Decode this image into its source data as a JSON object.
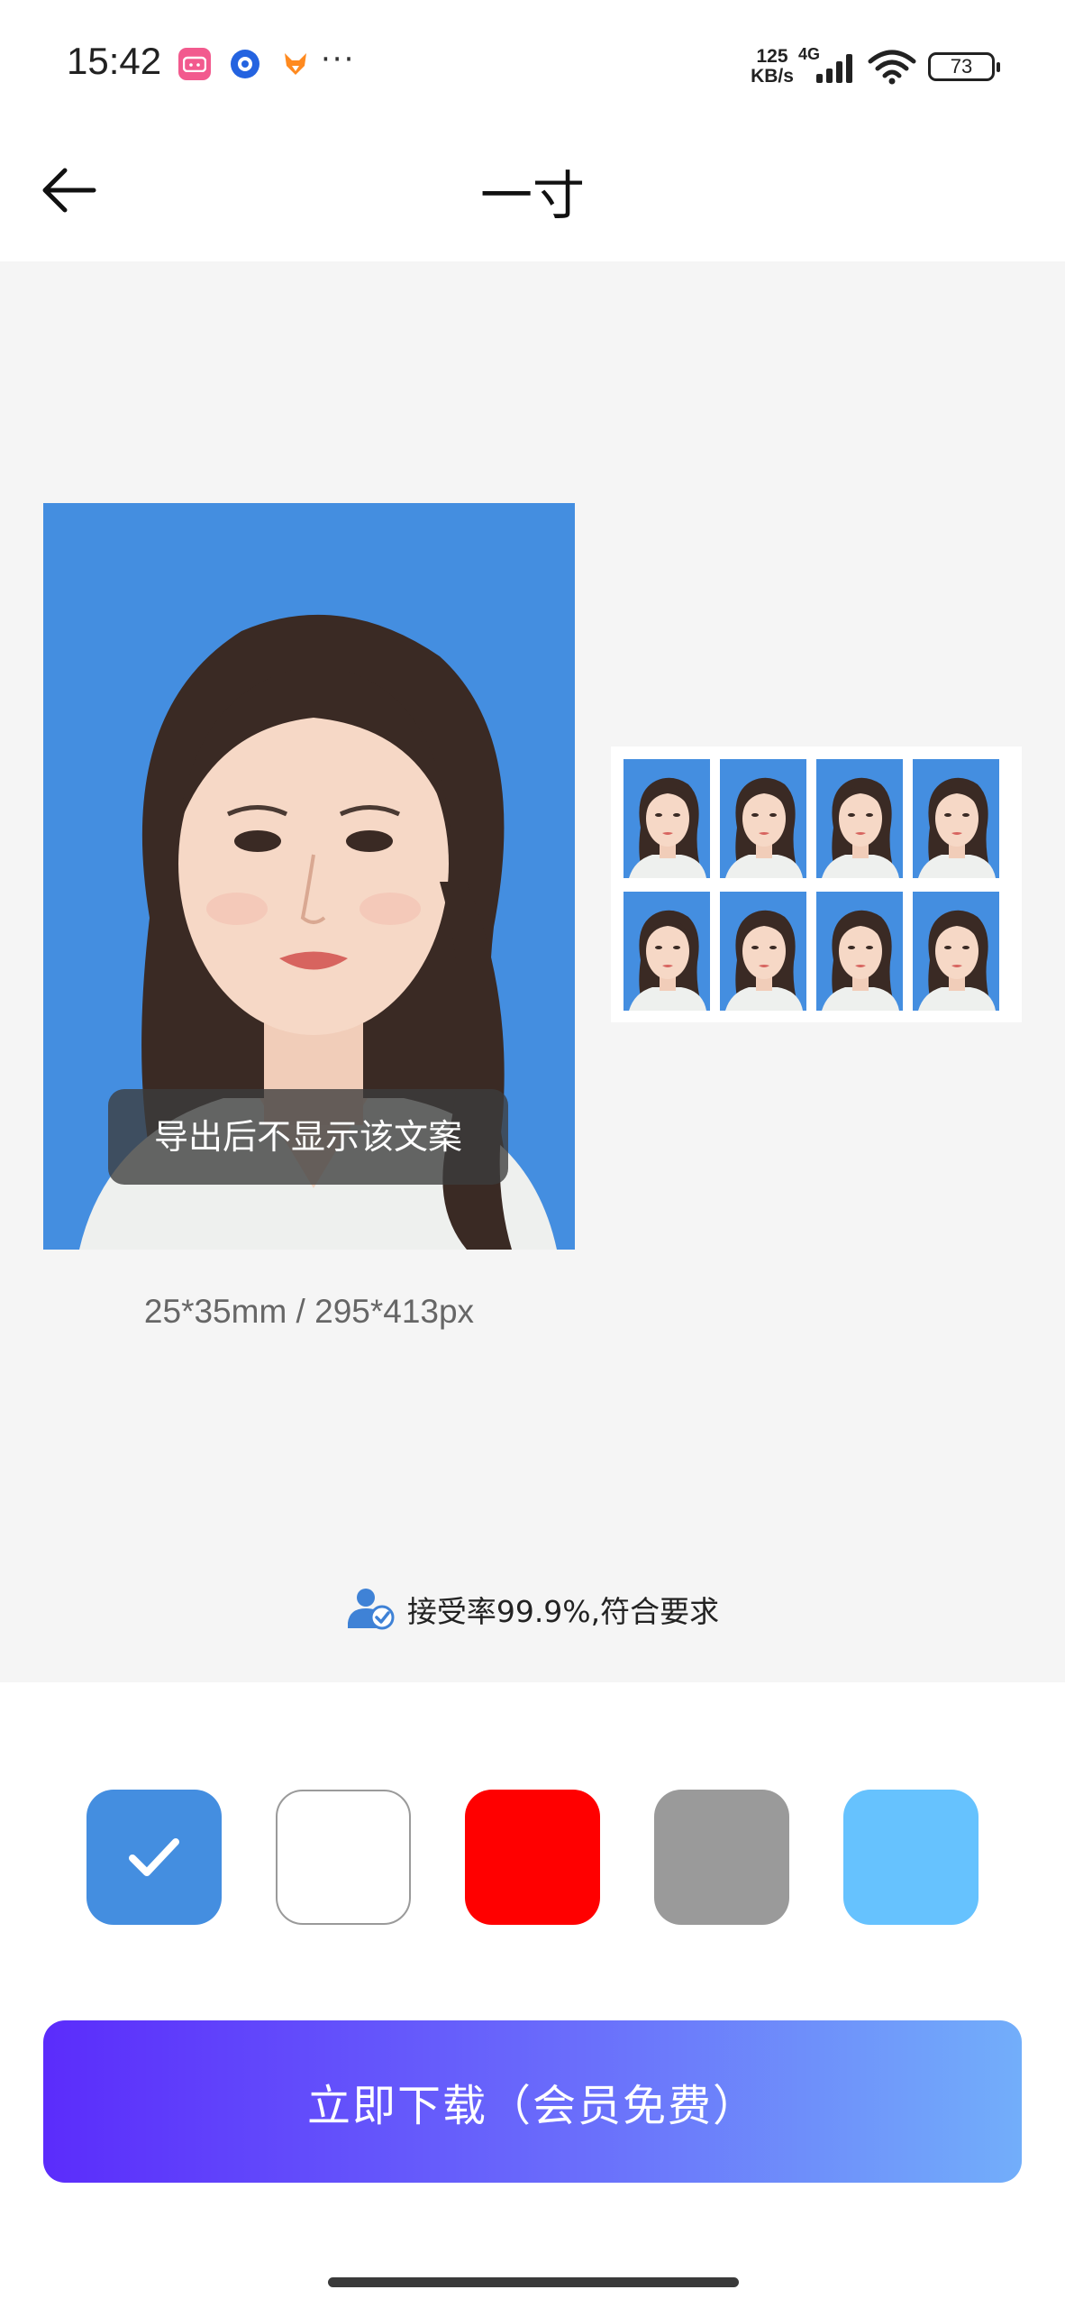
{
  "status_bar": {
    "time": "15:42",
    "more": "···",
    "net_speed_value": "125",
    "net_speed_unit": "KB/s",
    "network_type": "4G",
    "battery": "73",
    "icons": [
      "bilibili-app-icon",
      "circle-app-icon",
      "fox-app-icon",
      "signal-icon",
      "wifi-icon",
      "battery-icon"
    ]
  },
  "nav": {
    "back_icon": "arrow-left-icon",
    "title": "一寸"
  },
  "preview": {
    "watermark_text": "导出后不显示该文案",
    "size_info": "25*35mm / 295*413px",
    "sheet_count": 8,
    "acceptance_icon": "certified-person-icon",
    "acceptance_text": "接受率99.9%,符合要求"
  },
  "colors": {
    "selected_index": 0,
    "options": [
      {
        "name": "blue",
        "hex": "#448ee0"
      },
      {
        "name": "white",
        "hex": "#ffffff"
      },
      {
        "name": "red",
        "hex": "#ff0000"
      },
      {
        "name": "gray",
        "hex": "#9a9a9a"
      },
      {
        "name": "light-blue",
        "hex": "#66c2fe"
      }
    ]
  },
  "download": {
    "label": "立即下载（会员免费）"
  }
}
